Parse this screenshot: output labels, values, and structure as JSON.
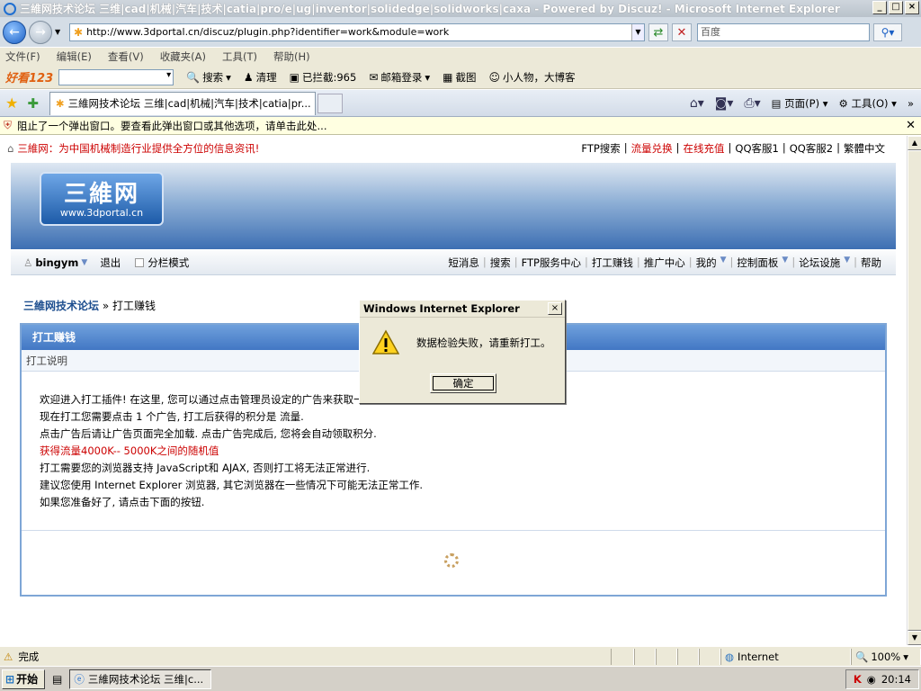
{
  "window": {
    "title": "三維网技术论坛 三维|cad|机械|汽车|技术|catia|pro/e|ug|inventor|solidedge|solidworks|caxa - Powered by Discuz! - Microsoft Internet Explorer",
    "buttons": {
      "minimize": "_",
      "maximize": "□",
      "close": "×"
    }
  },
  "addressbar": {
    "back": "←",
    "forward": "→",
    "url": "http://www.3dportal.cn/discuz/plugin.php?identifier=work&module=work",
    "search_placeholder": "百度"
  },
  "menu": [
    "文件(F)",
    "编辑(E)",
    "查看(V)",
    "收藏夹(A)",
    "工具(T)",
    "帮助(H)"
  ],
  "toolbar2": {
    "logo": "好看123",
    "items": [
      {
        "icon": "search-icon",
        "label": "搜索"
      },
      {
        "icon": "broom-icon",
        "label": "清理"
      },
      {
        "icon": "blocked-popup-icon",
        "label": "已拦截:965"
      },
      {
        "icon": "mail-icon",
        "label": "邮箱登录"
      },
      {
        "icon": "screenshot-icon",
        "label": "截图"
      },
      {
        "icon": "person-icon",
        "label": "小人物，大博客"
      }
    ]
  },
  "tabs": {
    "active_tab": "三維网技术论坛 三维|cad|机械|汽车|技术|catia|pr...",
    "commands": {
      "page": "页面(P)",
      "tools": "工具(O)"
    }
  },
  "infobar": {
    "text": "阻止了一个弹出窗口。要查看此弹出窗口或其他选项，请单击此处..."
  },
  "site": {
    "slogan": "三維网：为中国机械制造行业提供全方位的信息资讯!",
    "toplinks": [
      {
        "label": "FTP搜索",
        "highlight": false
      },
      {
        "label": "流量兑换",
        "highlight": true
      },
      {
        "label": "在线充值",
        "highlight": true
      },
      {
        "label": "QQ客服1",
        "highlight": false
      },
      {
        "label": "QQ客服2",
        "highlight": false
      },
      {
        "label": "繁體中文",
        "highlight": false
      }
    ],
    "logo_big": "三維网",
    "logo_small": "www.3dportal.cn",
    "user": "bingym",
    "logout": "退出",
    "split_mode": "分栏模式",
    "nav": [
      "短消息",
      "搜索",
      "FTP服务中心",
      "打工赚钱",
      "推广中心",
      "我的",
      "控制面板",
      "论坛设施",
      "帮助"
    ]
  },
  "breadcrumb": {
    "forum": "三維网技术论坛",
    "separator": "»",
    "current": "打工赚钱"
  },
  "mainbox": {
    "header": "打工赚钱",
    "subheader": "打工说明",
    "lines": [
      {
        "text": "欢迎进入打工插件! 在这里, 您可以通过点击管理员设定的广告来获取一定的积分",
        "red": false
      },
      {
        "text": "现在打工您需要点击 1 个广告, 打工后获得的积分是 流量.",
        "red": false
      },
      {
        "text": "点击广告后请让广告页面完全加载. 点击广告完成后, 您将会自动领取积分.",
        "red": false
      },
      {
        "text": "获得流量4000K-- 5000K之间的随机值",
        "red": true
      },
      {
        "text": "打工需要您的浏览器支持 JavaScript和 AJAX, 否则打工将无法正常进行.",
        "red": false
      },
      {
        "text": "建议您使用 Internet Explorer 浏览器, 其它浏览器在一些情况下可能无法正常工作.",
        "red": false
      },
      {
        "text": "如果您准备好了, 请点击下面的按钮.",
        "red": false
      }
    ]
  },
  "dialog": {
    "title": "Windows Internet Explorer",
    "message": "数据检验失败，请重新打工。",
    "ok": "确定",
    "close": "×"
  },
  "statusbar": {
    "text": "完成",
    "zone": "Internet",
    "zoom": "100%"
  },
  "taskbar": {
    "start": "开始",
    "task": "三維网技术论坛 三维|c...",
    "time": "20:14"
  },
  "colors": {
    "accent_red": "#cc0000",
    "forum_blue": "#1d4e8f",
    "box_header": "#4277c4"
  }
}
